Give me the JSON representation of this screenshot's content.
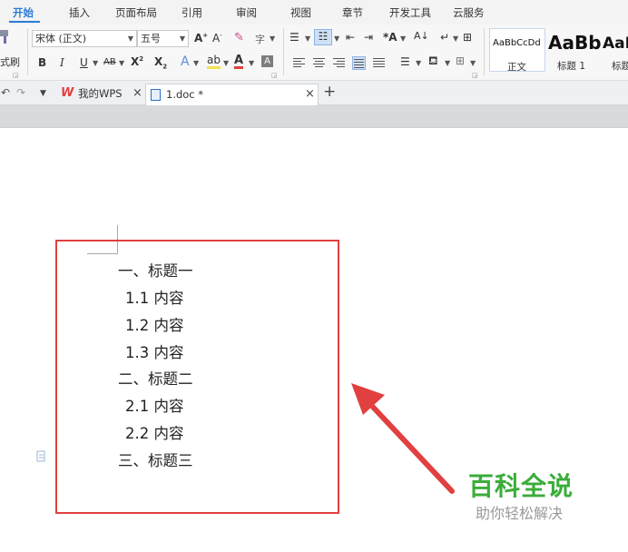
{
  "menu": {
    "tabs": [
      "开始",
      "插入",
      "页面布局",
      "引用",
      "审阅",
      "视图",
      "章节",
      "开发工具",
      "云服务"
    ],
    "active_tab": "开始"
  },
  "ribbon": {
    "format_painter_partial": "式刷",
    "font_name": "宋体 (正文)",
    "font_size": "五号",
    "styles": [
      {
        "sample": "AaBbCcDd",
        "name": "正文"
      },
      {
        "sample": "AaBb",
        "name": "标题 1"
      },
      {
        "sample": "AaI",
        "name": "标题"
      }
    ]
  },
  "tabstrip": {
    "tabs": [
      {
        "label": "我的WPS",
        "active": false
      },
      {
        "label": "1.doc *",
        "active": true
      }
    ],
    "new_tab_symbol": "+"
  },
  "document": {
    "lines": [
      "一、标题一",
      "1.1 内容",
      "1.2 内容",
      "1.3 内容",
      "二、标题二",
      "2.1 内容",
      "2.2  内容",
      "三、标题三"
    ]
  },
  "annotation": {
    "box_color": "#e0403f",
    "arrow_color": "#e0403f"
  },
  "watermark": {
    "title": "百科全说",
    "subtitle": "助你轻松解决",
    "title_color": "#3aad3a"
  },
  "colors": {
    "accent": "#2b7bd4",
    "wps_logo": "#e0403f"
  }
}
